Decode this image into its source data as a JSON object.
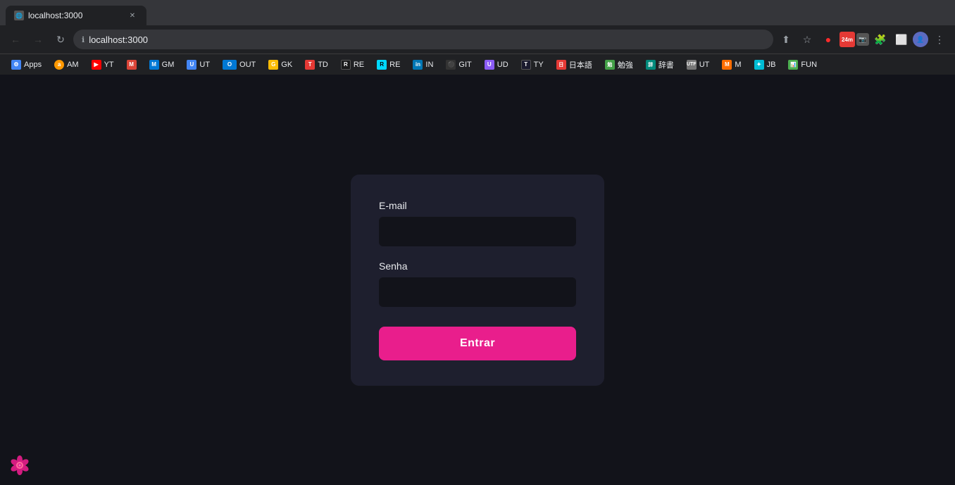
{
  "browser": {
    "url": "localhost:3000",
    "tab_title": "localhost:3000"
  },
  "bookmarks": [
    {
      "label": "Apps",
      "color": "#4285f4",
      "text_color": "#fff",
      "abbr": "Apps"
    },
    {
      "label": "AM",
      "color": "#ff9900",
      "abbr": "AM"
    },
    {
      "label": "YT",
      "color": "#ff0000",
      "abbr": "YT"
    },
    {
      "label": "GM",
      "color": "#db4437",
      "abbr": "GM"
    },
    {
      "label": "UT",
      "color": "#4285f4",
      "abbr": "UT"
    },
    {
      "label": "OUT",
      "color": "#0078d4",
      "abbr": "OUT"
    },
    {
      "label": "GK",
      "color": "#fbbc05",
      "abbr": "GK"
    },
    {
      "label": "TD",
      "color": "#e53935",
      "abbr": "TD"
    },
    {
      "label": "RE",
      "color": "#000000",
      "abbr": "RE"
    },
    {
      "label": "RE",
      "color": "#00d9ff",
      "abbr": "RE"
    },
    {
      "label": "IN",
      "color": "#0077b5",
      "abbr": "IN"
    },
    {
      "label": "GIT",
      "color": "#333",
      "abbr": "GIT"
    },
    {
      "label": "UD",
      "color": "#8b5cf6",
      "abbr": "UD"
    },
    {
      "label": "TY",
      "color": "#1a1a2e",
      "abbr": "TY"
    },
    {
      "label": "日本語",
      "color": "#e53935",
      "abbr": "日"
    },
    {
      "label": "勉強",
      "color": "#43a047",
      "abbr": "勉"
    },
    {
      "label": "辞書",
      "color": "#00897b",
      "abbr": "辞"
    },
    {
      "label": "UT",
      "color": "#555",
      "abbr": "UT"
    },
    {
      "label": "M",
      "color": "#ff6d00",
      "abbr": "M"
    },
    {
      "label": "JB",
      "color": "#00bcd4",
      "abbr": "JB"
    },
    {
      "label": "FUN",
      "color": "#4caf50",
      "abbr": "FUN"
    }
  ],
  "form": {
    "email_label": "E-mail",
    "email_placeholder": "",
    "password_label": "Senha",
    "password_placeholder": "",
    "submit_label": "Entrar"
  },
  "colors": {
    "page_bg": "#12131a",
    "card_bg": "#1e1f2e",
    "input_bg": "#12131a",
    "button_bg": "#e91e8c",
    "label_color": "#e8eaed"
  }
}
